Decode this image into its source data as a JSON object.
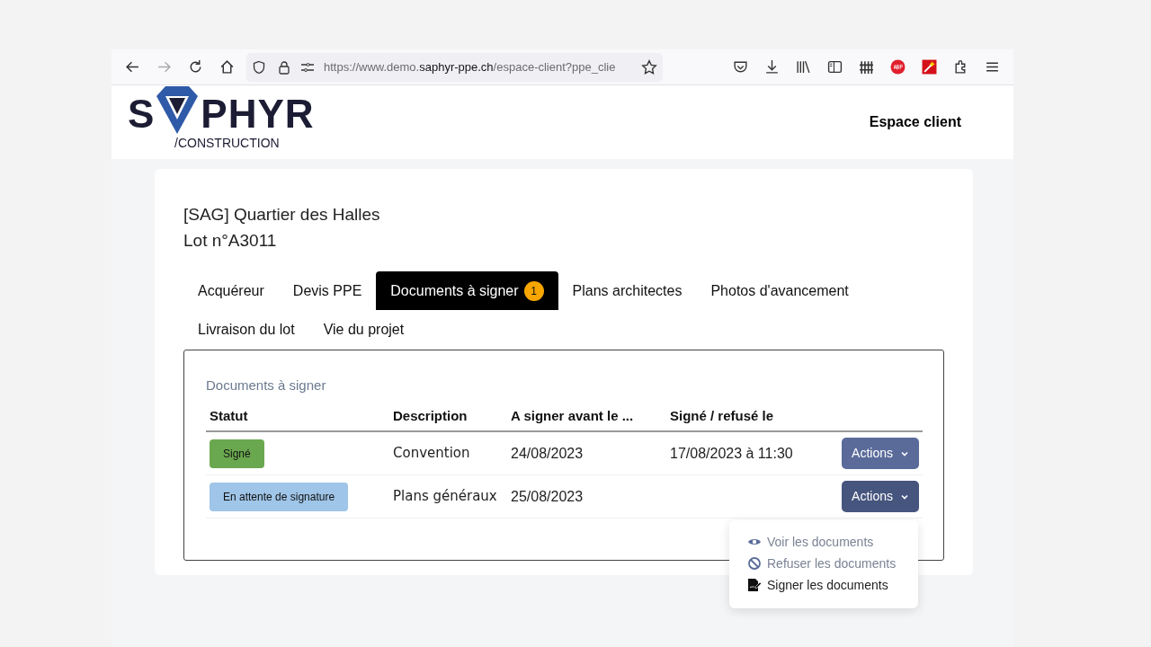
{
  "browser": {
    "url": "https://www.demo.**saphyr-ppe.ch**/espace-client?ppe_clie"
  },
  "header": {
    "logo": {
      "left": "S",
      "right": "PHYR",
      "sub": "/CONSTRUCTION"
    },
    "nav_link": "Espace client"
  },
  "project": {
    "title": "[SAG] Quartier des Halles",
    "lot": "Lot n°A3011"
  },
  "tabs": [
    {
      "label": "Acquéreur",
      "selected": false
    },
    {
      "label": "Devis PPE",
      "selected": false
    },
    {
      "label": "Documents à signer",
      "selected": true,
      "badge": "1"
    },
    {
      "label": "Plans architectes",
      "selected": false
    },
    {
      "label": "Photos d'avancement",
      "selected": false
    },
    {
      "label": "Livraison du lot",
      "selected": false
    },
    {
      "label": "Vie du projet",
      "selected": false
    }
  ],
  "panel": {
    "caption": "Documents à signer",
    "table": {
      "columns": [
        "Statut",
        "Description",
        "A signer avant le ...",
        "Signé / refusé le"
      ],
      "rows": [
        {
          "status": "Signé",
          "color": "#6aa84f",
          "description": "Convention",
          "due": "24/08/2023",
          "signed": "17/08/2023 à 11:30",
          "action": "Actions",
          "expanded": false
        },
        {
          "status": "En attente de signature",
          "color": "#9fc5e8",
          "description": "Plans généraux",
          "due": "25/08/2023",
          "action": "Actions",
          "expanded": true
        }
      ]
    }
  },
  "menu": {
    "items": [
      {
        "kind": "view",
        "label": "Voir les documents",
        "disabled": true
      },
      {
        "kind": "refuse",
        "label": "Refuser les documents",
        "disabled": true
      },
      {
        "kind": "sign",
        "label": "Signer les documents",
        "disabled": false
      }
    ]
  }
}
